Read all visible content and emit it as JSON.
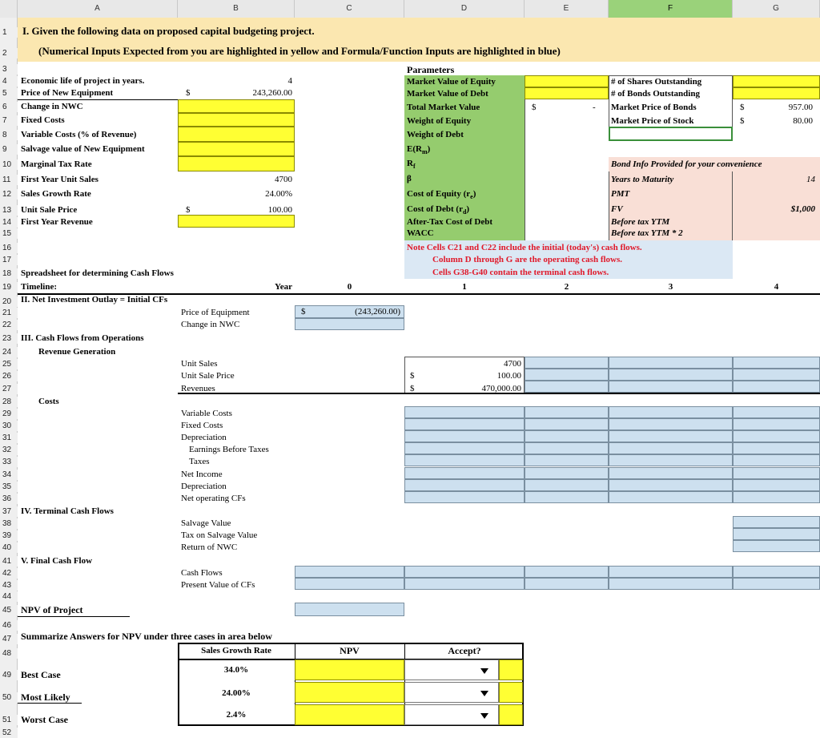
{
  "columns": [
    "A",
    "B",
    "C",
    "D",
    "E",
    "F",
    "G"
  ],
  "rows": [
    "1",
    "2",
    "3",
    "4",
    "5",
    "6",
    "7",
    "8",
    "9",
    "10",
    "11",
    "12",
    "13",
    "14",
    "15",
    "16",
    "17",
    "18",
    "19",
    "20",
    "21",
    "22",
    "23",
    "24",
    "25",
    "26",
    "27",
    "28",
    "29",
    "30",
    "31",
    "32",
    "33",
    "34",
    "35",
    "36",
    "37",
    "38",
    "39",
    "40",
    "41",
    "42",
    "43",
    "44",
    "45",
    "46",
    "47",
    "48",
    "49",
    "50",
    "51",
    "52"
  ],
  "header": {
    "title": "I. Given the following data on proposed capital budgeting project.",
    "subtitle": "(Numerical Inputs Expected from you are highlighted in yellow and Formula/Function Inputs are highlighted in blue)"
  },
  "inputs": {
    "economic_life_label": "Economic life of project in years.",
    "economic_life_value": "4",
    "price_equipment_label": "Price of New Equipment",
    "price_equipment_cur": "$",
    "price_equipment_value": "243,260.00",
    "change_nwc_label": "Change in NWC",
    "fixed_costs_label": "Fixed Costs",
    "variable_costs_label": "Variable Costs (% of Revenue)",
    "salvage_label": "Salvage value of New Equipment",
    "tax_label": "Marginal Tax Rate",
    "unit_sales_label": "First Year Unit Sales",
    "unit_sales_value": "4700",
    "growth_label": "Sales Growth Rate",
    "growth_value": "24.00%",
    "unit_price_label": "Unit Sale Price",
    "unit_price_cur": "$",
    "unit_price_value": "100.00",
    "revenue_label": "First Year Revenue"
  },
  "parameters": {
    "heading": "Parameters",
    "market_value_equity": "Market Value of Equity",
    "market_value_debt": "Market Value of Debt",
    "total_market_value": "Total Market Value",
    "total_cur": "$",
    "total_value": "-",
    "weight_equity": "Weight of Equity",
    "weight_debt": "Weight of Debt",
    "erm": "E(R",
    "erm_sub": "m",
    "rf": "R",
    "rf_sub": "f",
    "beta": "β",
    "cost_equity": "Cost of Equity (r",
    "cost_equity_sub": "e",
    "cost_debt": "Cost of Debt (r",
    "cost_debt_sub": "d",
    "after_tax": "After-Tax Cost of Debt",
    "wacc": "WACC",
    "shares_outstanding": "# of Shares Outstanding",
    "bonds_outstanding": "# of Bonds Outstanding",
    "price_bonds": "Market Price of Bonds",
    "price_bonds_cur": "$",
    "price_bonds_value": "957.00",
    "price_stock": "Market Price of Stock",
    "price_stock_cur": "$",
    "price_stock_value": "80.00"
  },
  "bond_info": {
    "heading": "Bond Info Provided for your convenience",
    "years_label": "Years to Maturity",
    "years_value": "14",
    "pmt_label": "PMT",
    "fv_label": "FV",
    "fv_value": "$1,000",
    "ytm_label": "Before tax YTM",
    "ytm2_label": "Before tax YTM * 2"
  },
  "note": {
    "line1": "Note Cells C21 and C22 include the initial (today's) cash flows.",
    "line2": "Column D through G are the operating cash flows.",
    "line3": "Cells G38-G40 contain the terminal cash flows."
  },
  "cashflows": {
    "heading": "Spreadsheet for determining Cash Flows",
    "timeline": "Timeline:",
    "year": "Year",
    "years": [
      "0",
      "1",
      "2",
      "3",
      "4"
    ],
    "net_investment": "II. Net Investment Outlay = Initial CFs",
    "price_equipment": "Price of Equipment",
    "price_equipment_cur": "$",
    "price_equipment_value": "(243,260.00)",
    "change_nwc": "Change in NWC",
    "operations": "III. Cash Flows from Operations",
    "revenue_generation": "Revenue Generation",
    "unit_sales": "Unit Sales",
    "unit_sales_value": "4700",
    "unit_price": "Unit Sale Price",
    "unit_price_cur": "$",
    "unit_price_value": "100.00",
    "revenues": "Revenues",
    "revenues_cur": "$",
    "revenues_value": "470,000.00",
    "costs": "Costs",
    "variable_costs": "Variable Costs",
    "fixed_costs": "Fixed Costs",
    "depreciation": "Depreciation",
    "ebt": "Earnings Before Taxes",
    "taxes": "Taxes",
    "net_income": "Net Income",
    "depreciation2": "Depreciation",
    "net_operating": "Net operating CFs",
    "terminal": "IV. Terminal Cash Flows",
    "salvage": "Salvage Value",
    "tax_salvage": "Tax on Salvage Value",
    "return_nwc": "Return of NWC",
    "final": "V. Final Cash Flow",
    "cash_flows": "Cash Flows",
    "pv_cfs": "Present Value of CFs"
  },
  "npv": {
    "label": "NPV of Project"
  },
  "summary": {
    "heading": "Summarize Answers for NPV under three cases in area below",
    "col_growth": "Sales Growth Rate",
    "col_npv": "NPV",
    "col_accept": "Accept?",
    "rows": [
      {
        "label": "Best Case",
        "growth": "34.0%"
      },
      {
        "label": "Most Likely",
        "growth": "24.00%"
      },
      {
        "label": "Worst Case",
        "growth": "2.4%"
      }
    ]
  }
}
